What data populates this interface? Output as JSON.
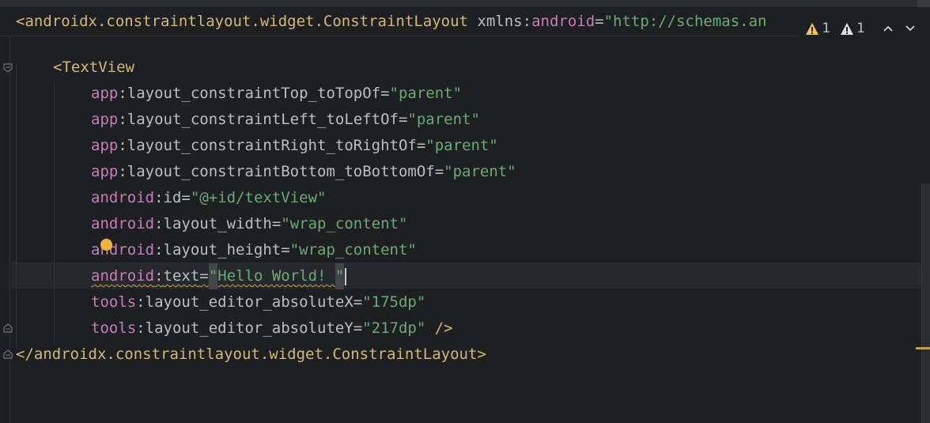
{
  "header": {
    "open_tag": "<androidx.constraintlayout.widget.ConstraintLayout",
    "xmlns_prefix": "xmlns",
    "xmlns_ns": "android",
    "xmlns_value": "\"http://schemas.an"
  },
  "inspections": {
    "warnings_count": "1",
    "weak_warnings_count": "1",
    "up_icon": "chevron-up-icon",
    "down_icon": "chevron-down-icon"
  },
  "code": {
    "textview_open": "<TextView",
    "attrs": [
      {
        "ns": "app",
        "name": "layout_constraintTop_toTopOf",
        "value": "\"parent\""
      },
      {
        "ns": "app",
        "name": "layout_constraintLeft_toLeftOf",
        "value": "\"parent\""
      },
      {
        "ns": "app",
        "name": "layout_constraintRight_toRightOf",
        "value": "\"parent\""
      },
      {
        "ns": "app",
        "name": "layout_constraintBottom_toBottomOf",
        "value": "\"parent\""
      },
      {
        "ns": "android",
        "name": "id",
        "value": "\"@+id/textView\""
      },
      {
        "ns": "android",
        "name": "layout_width",
        "value": "\"wrap_content\""
      },
      {
        "ns": "android",
        "name": "layout_height",
        "value": "\"wrap_content\""
      },
      {
        "ns": "android",
        "name": "text",
        "value_part1": "\"",
        "value_part2": "Hello World! ",
        "value_part3": "\""
      },
      {
        "ns": "tools",
        "name": "layout_editor_absoluteX",
        "value": "\"175dp\""
      },
      {
        "ns": "tools",
        "name": "layout_editor_absoluteY",
        "value": "\"217dp\"",
        "suffix": " />"
      }
    ],
    "close_tag": "</androidx.constraintlayout.widget.ConstraintLayout>"
  },
  "colors": {
    "background": "#1e1f22",
    "tag": "#d5b778",
    "namespace": "#c77dbb",
    "value": "#6aab73",
    "warning": "#c8a03c"
  }
}
